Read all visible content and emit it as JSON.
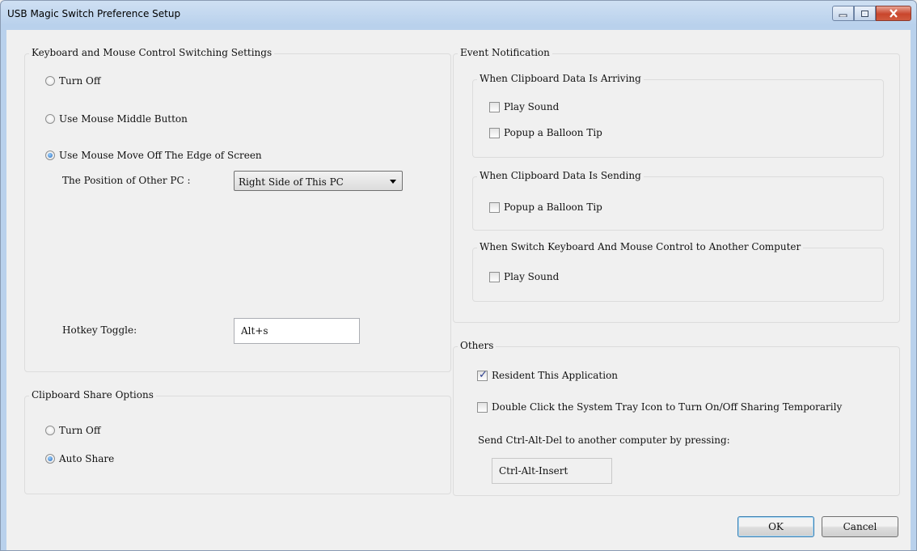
{
  "window": {
    "title": "USB Magic Switch Preference Setup",
    "controls": {
      "minimize": "minimize-icon",
      "maximize": "maximize-icon",
      "close": "close-icon"
    }
  },
  "keyboard_mouse": {
    "legend": "Keyboard and Mouse Control Switching Settings",
    "options": [
      "Turn Off",
      "Use Mouse Middle Button",
      "Use Mouse Move Off The Edge of Screen"
    ],
    "selected_index": 2,
    "position_label": "The Position of Other PC :",
    "position_value": "Right Side of This PC",
    "hotkey_label": "Hotkey Toggle:",
    "hotkey_value": "Alt+s"
  },
  "clipboard": {
    "legend": "Clipboard Share Options",
    "options": [
      "Turn Off",
      "Auto Share"
    ],
    "selected_index": 1
  },
  "event_notification": {
    "legend": "Event Notification",
    "arriving": {
      "legend": "When Clipboard Data Is Arriving",
      "play_sound": {
        "label": "Play Sound",
        "checked": false
      },
      "balloon": {
        "label": "Popup a Balloon Tip",
        "checked": false
      }
    },
    "sending": {
      "legend": "When Clipboard Data Is Sending",
      "balloon": {
        "label": "Popup a Balloon Tip",
        "checked": false
      }
    },
    "switch": {
      "legend": "When Switch Keyboard And Mouse Control to Another Computer",
      "play_sound": {
        "label": "Play Sound",
        "checked": false
      }
    }
  },
  "others": {
    "legend": "Others",
    "resident": {
      "label": "Resident This Application",
      "checked": true
    },
    "double_click": {
      "label": "Double Click the System Tray Icon to Turn On/Off Sharing Temporarily",
      "checked": false
    },
    "cad_label": "Send Ctrl-Alt-Del to another computer by pressing:",
    "cad_value": "Ctrl-Alt-Insert"
  },
  "buttons": {
    "ok": "OK",
    "cancel": "Cancel"
  },
  "colors": {
    "title_gradient_top": "#cfe0f3",
    "close_button": "#c9462c",
    "checkbox_check": "#2a3c8c",
    "radio_dot": "#2a6ab8"
  }
}
